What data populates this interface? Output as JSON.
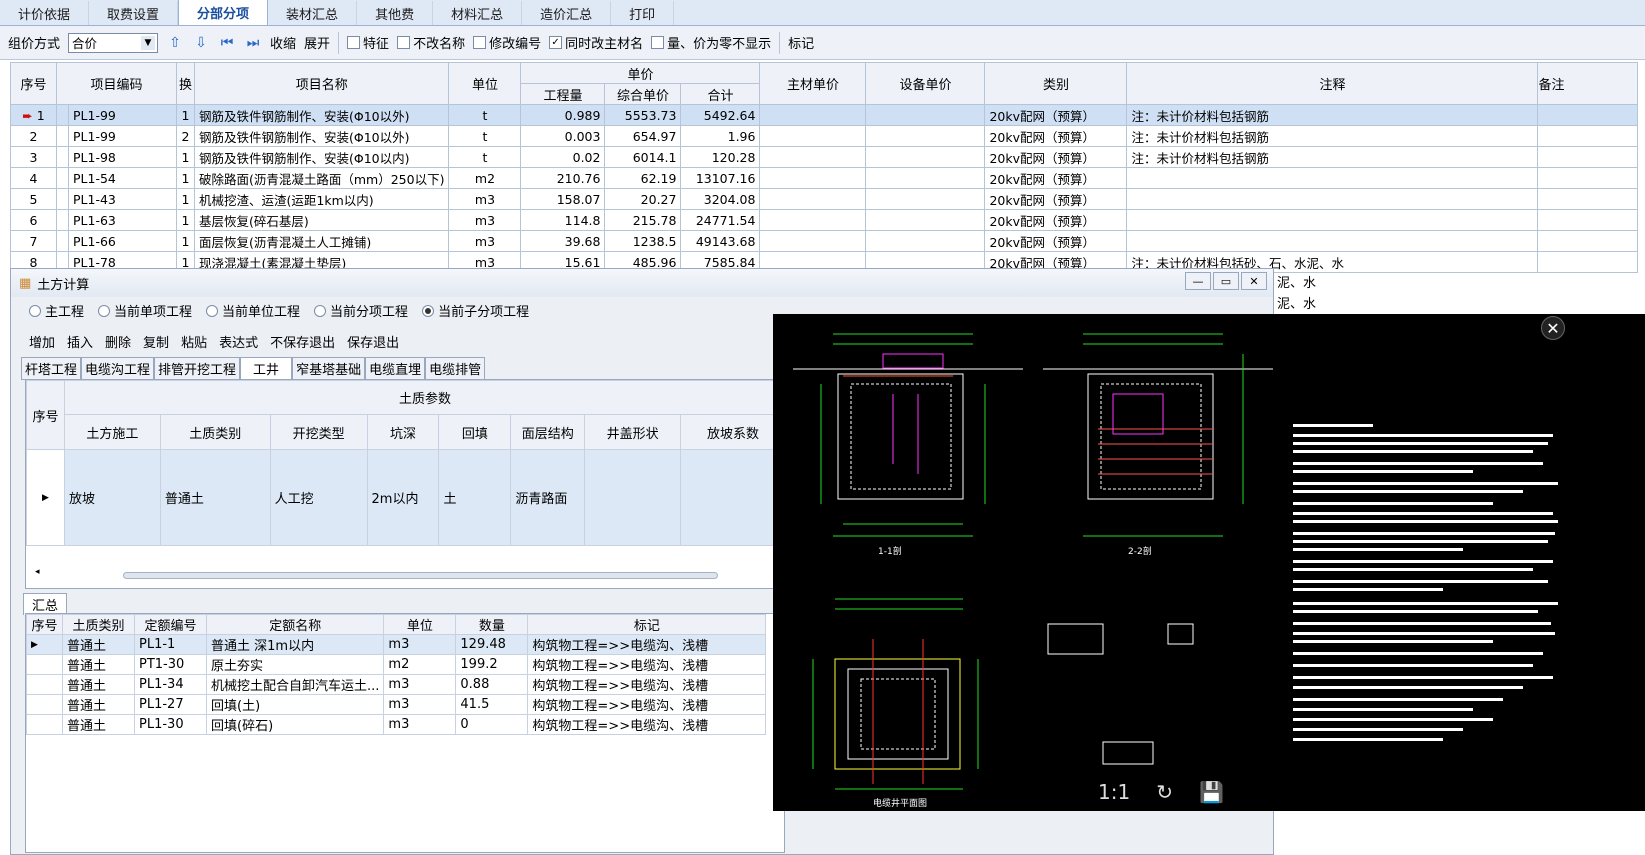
{
  "tabs": [
    "计价依据",
    "取费设置",
    "分部分项",
    "装材汇总",
    "其他费",
    "材料汇总",
    "造价汇总",
    "打印"
  ],
  "toolbar": {
    "group_label": "组价方式",
    "group_value": "合价",
    "collapse": "收缩",
    "expand": "展开",
    "cb_feature": "特征",
    "cb_noname": "不改名称",
    "cb_modcode": "修改编号",
    "cb_sync": "同时改主材名",
    "cb_zero": "量、价为零不显示",
    "mark": "标记"
  },
  "main": {
    "headers": {
      "seq": "序号",
      "code": "项目编码",
      "swap": "换",
      "name": "项目名称",
      "unit": "单位",
      "price_group": "单价",
      "qty": "工程量",
      "unit_price": "综合单价",
      "total": "合计",
      "main_mat": "主材单价",
      "equip": "设备单价",
      "category": "类别",
      "note": "注释",
      "remark": "备注"
    },
    "rows": [
      {
        "seq": "1",
        "code": "PL1-99",
        "swap": "1",
        "name": "钢筋及铁件钢筋制作、安装(Φ10以外)",
        "unit": "t",
        "qty": "0.989",
        "price": "5553.73",
        "total": "5492.64",
        "cat": "20kv配网（预算）",
        "note": "注：未计价材料包括钢筋"
      },
      {
        "seq": "2",
        "code": "PL1-99",
        "swap": "2",
        "name": "钢筋及铁件钢筋制作、安装(Φ10以外)",
        "unit": "t",
        "qty": "0.003",
        "price": "654.97",
        "total": "1.96",
        "cat": "20kv配网（预算）",
        "note": "注：未计价材料包括钢筋"
      },
      {
        "seq": "3",
        "code": "PL1-98",
        "swap": "1",
        "name": "钢筋及铁件钢筋制作、安装(Φ10以内)",
        "unit": "t",
        "qty": "0.02",
        "price": "6014.1",
        "total": "120.28",
        "cat": "20kv配网（预算）",
        "note": "注：未计价材料包括钢筋"
      },
      {
        "seq": "4",
        "code": "PL1-54",
        "swap": "1",
        "name": "破除路面(沥青混凝土路面（mm）250以下)",
        "unit": "m2",
        "qty": "210.76",
        "price": "62.19",
        "total": "13107.16",
        "cat": "20kv配网（预算）",
        "note": ""
      },
      {
        "seq": "5",
        "code": "PL1-43",
        "swap": "1",
        "name": "机械挖渣、运渣(运距1km以内)",
        "unit": "m3",
        "qty": "158.07",
        "price": "20.27",
        "total": "3204.08",
        "cat": "20kv配网（预算）",
        "note": ""
      },
      {
        "seq": "6",
        "code": "PL1-63",
        "swap": "1",
        "name": "基层恢复(碎石基层)",
        "unit": "m3",
        "qty": "114.8",
        "price": "215.78",
        "total": "24771.54",
        "cat": "20kv配网（预算）",
        "note": ""
      },
      {
        "seq": "7",
        "code": "PL1-66",
        "swap": "1",
        "name": "面层恢复(沥青混凝土人工摊铺)",
        "unit": "m3",
        "qty": "39.68",
        "price": "1238.5",
        "total": "49143.68",
        "cat": "20kv配网（预算）",
        "note": ""
      },
      {
        "seq": "8",
        "code": "PL1-78",
        "swap": "1",
        "name": "现浇混凝土(素混凝土垫层)",
        "unit": "m3",
        "qty": "15.61",
        "price": "485.96",
        "total": "7585.84",
        "cat": "20kv配网（预算）",
        "note": "注：未计价材料包括砂、石、水泥、水"
      }
    ],
    "partial_notes": [
      "泥、水",
      "泥、水"
    ]
  },
  "dialog": {
    "title": "土方计算",
    "radios": [
      "主工程",
      "当前单项工程",
      "当前单位工程",
      "当前分项工程",
      "当前子分项工程"
    ],
    "tools": [
      "增加",
      "插入",
      "删除",
      "复制",
      "粘贴",
      "表达式",
      "不保存退出",
      "保存退出"
    ],
    "subtabs": [
      "杆塔工程",
      "电缆沟工程",
      "排管开挖工程",
      "工井",
      "窄基塔基础",
      "电缆直埋",
      "电缆排管"
    ],
    "soil": {
      "seq": "序号",
      "group": "土质参数",
      "cols": [
        "土方施工",
        "土质类别",
        "开挖类型",
        "坑深",
        "回填",
        "面层结构",
        "井盖形状",
        "放坡系数"
      ],
      "row": [
        "放坡",
        "普通土",
        "人工挖",
        "2m以内",
        "土",
        "沥青路面",
        "",
        ""
      ]
    },
    "sum_tab": "汇总",
    "sum": {
      "headers": [
        "序号",
        "土质类别",
        "定额编号",
        "定额名称",
        "单位",
        "数量",
        "标记"
      ],
      "rows": [
        [
          "",
          "普通土",
          "PL1-1",
          "普通土 深1m以内",
          "m3",
          "129.48",
          "构筑物工程=>>电缆沟、浅槽"
        ],
        [
          "",
          "普通土",
          "PT1-30",
          "原土夯实",
          "m2",
          "199.2",
          "构筑物工程=>>电缆沟、浅槽"
        ],
        [
          "",
          "普通土",
          "PL1-34",
          "机械挖土配合自卸汽车运土...",
          "m3",
          "0.88",
          "构筑物工程=>>电缆沟、浅槽"
        ],
        [
          "",
          "普通土",
          "PL1-27",
          "回填(土)",
          "m3",
          "41.5",
          "构筑物工程=>>电缆沟、浅槽"
        ],
        [
          "",
          "普通土",
          "PL1-30",
          "回填(碎石)",
          "m3",
          "0",
          "构筑物工程=>>电缆沟、浅槽"
        ]
      ]
    }
  },
  "viewer": {
    "zoom": "1:1",
    "section1": "1-1剖",
    "section2": "2-2剖",
    "plan": "电缆井平面图"
  }
}
